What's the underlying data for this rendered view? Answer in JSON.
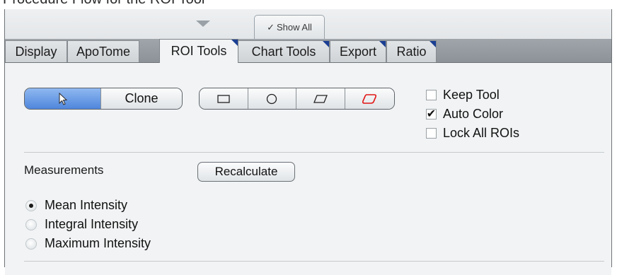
{
  "top_cut_text": "Procedure Flow for the ROI Tool",
  "panel": {
    "show_all_label": "Show All",
    "show_all_check": "✓"
  },
  "tabs": [
    {
      "label": "Display",
      "active": false,
      "flag": false
    },
    {
      "label": "ApoTome",
      "active": false,
      "flag": false
    },
    {
      "label": "ROI Tools",
      "active": true,
      "flag": true
    },
    {
      "label": "Chart Tools",
      "active": false,
      "flag": true
    },
    {
      "label": "Export",
      "active": false,
      "flag": true
    },
    {
      "label": "Ratio",
      "active": false,
      "flag": true
    }
  ],
  "tool_group": {
    "pointer_icon": "pointer-arrow-icon",
    "clone_label": "Clone"
  },
  "shape_group": {
    "shapes": [
      "rectangle-icon",
      "circle-icon",
      "parallelogram-icon",
      "rounded-parallelogram-icon"
    ],
    "active_color": "#e11414"
  },
  "options": [
    {
      "label": "Keep Tool",
      "checked": false
    },
    {
      "label": "Auto Color",
      "checked": true
    },
    {
      "label": "Lock All ROIs",
      "checked": false
    }
  ],
  "measurements": {
    "label": "Measurements",
    "recalculate_label": "Recalculate",
    "options": [
      {
        "label": "Mean Intensity",
        "selected": true
      },
      {
        "label": "Integral Intensity",
        "selected": false
      },
      {
        "label": "Maximum Intensity",
        "selected": false
      }
    ]
  },
  "colors": {
    "selected_blue": "#4f86dc",
    "tab_flag": "#1b3f93",
    "panel_bg": "#f1f3f4"
  }
}
